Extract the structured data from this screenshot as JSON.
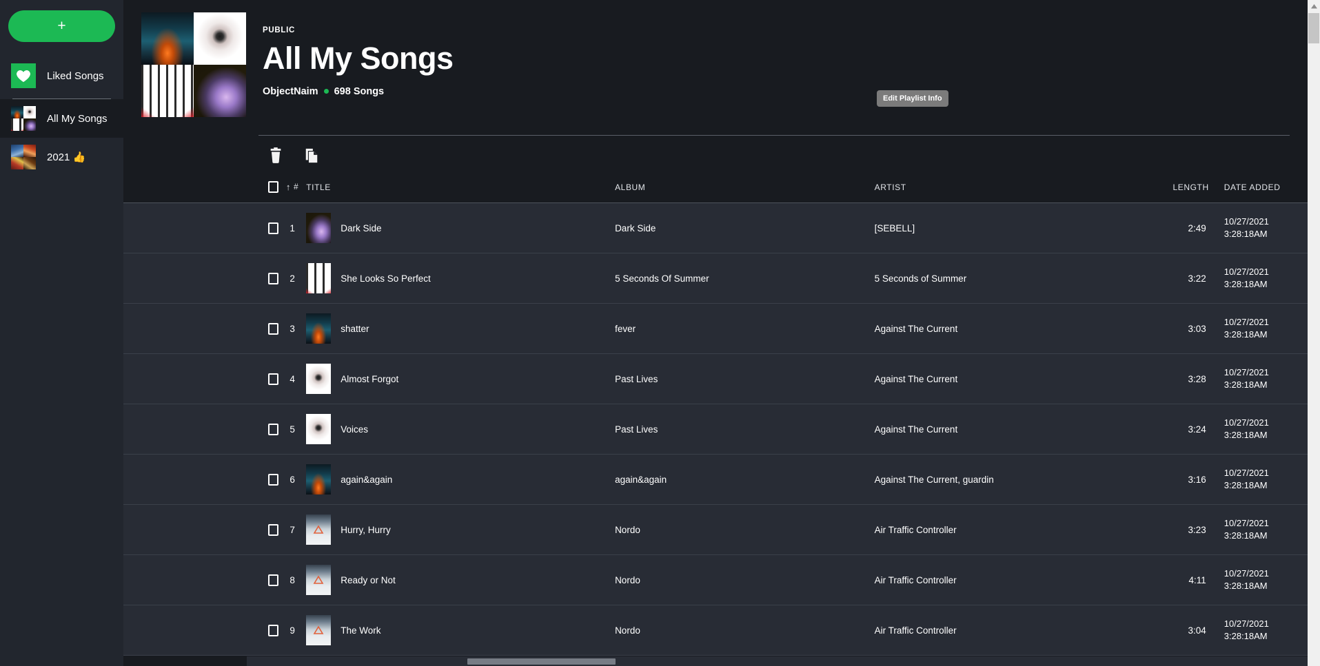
{
  "sidebar": {
    "add_button_label": "+",
    "liked": {
      "label": "Liked Songs",
      "icon": "heart-icon"
    },
    "playlists": [
      {
        "label": "All My Songs",
        "active": true
      },
      {
        "label": "2021 👍",
        "active": false
      }
    ]
  },
  "header": {
    "visibility": "PUBLIC",
    "title": "All My Songs",
    "owner": "ObjectNaim",
    "song_count": "698 Songs",
    "edit_button_label": "Edit Playlist Info",
    "accent_color": "#1cb954"
  },
  "actionbar": {
    "delete_label": "trash-icon",
    "copy_label": "copy-icon"
  },
  "table": {
    "columns": {
      "select": "",
      "sort_arrow": "↑",
      "number": "#",
      "title": "TITLE",
      "album": "ALBUM",
      "artist": "ARTIST",
      "length": "LENGTH",
      "date_added": "DATE ADDED"
    },
    "rows": [
      {
        "num": "1",
        "title": "Dark Side",
        "album": "Dark Side",
        "artist": "[SEBELL]",
        "length": "2:49",
        "date": "10/27/2021",
        "time": "3:28:18AM",
        "art": "art-darkside"
      },
      {
        "num": "2",
        "title": "She Looks So Perfect",
        "album": "5 Seconds Of Summer",
        "artist": "5 Seconds of Summer",
        "length": "3:22",
        "date": "10/27/2021",
        "time": "3:28:18AM",
        "art": "art-5sos"
      },
      {
        "num": "3",
        "title": "shatter",
        "album": "fever",
        "artist": "Against The Current",
        "length": "3:03",
        "date": "10/27/2021",
        "time": "3:28:18AM",
        "art": "art-fever"
      },
      {
        "num": "4",
        "title": "Almost Forgot",
        "album": "Past Lives",
        "artist": "Against The Current",
        "length": "3:28",
        "date": "10/27/2021",
        "time": "3:28:18AM",
        "art": "art-pastlives"
      },
      {
        "num": "5",
        "title": "Voices",
        "album": "Past Lives",
        "artist": "Against The Current",
        "length": "3:24",
        "date": "10/27/2021",
        "time": "3:28:18AM",
        "art": "art-pastlives"
      },
      {
        "num": "6",
        "title": "again&again",
        "album": "again&again",
        "artist": "Against The Current, guardin",
        "length": "3:16",
        "date": "10/27/2021",
        "time": "3:28:18AM",
        "art": "art-fever"
      },
      {
        "num": "7",
        "title": "Hurry, Hurry",
        "album": "Nordo",
        "artist": "Air Traffic Controller",
        "length": "3:23",
        "date": "10/27/2021",
        "time": "3:28:18AM",
        "art": "art-nordo"
      },
      {
        "num": "8",
        "title": "Ready or Not",
        "album": "Nordo",
        "artist": "Air Traffic Controller",
        "length": "4:11",
        "date": "10/27/2021",
        "time": "3:28:18AM",
        "art": "art-nordo"
      },
      {
        "num": "9",
        "title": "The Work",
        "album": "Nordo",
        "artist": "Air Traffic Controller",
        "length": "3:04",
        "date": "10/27/2021",
        "time": "3:28:18AM",
        "art": "art-nordo"
      }
    ]
  }
}
